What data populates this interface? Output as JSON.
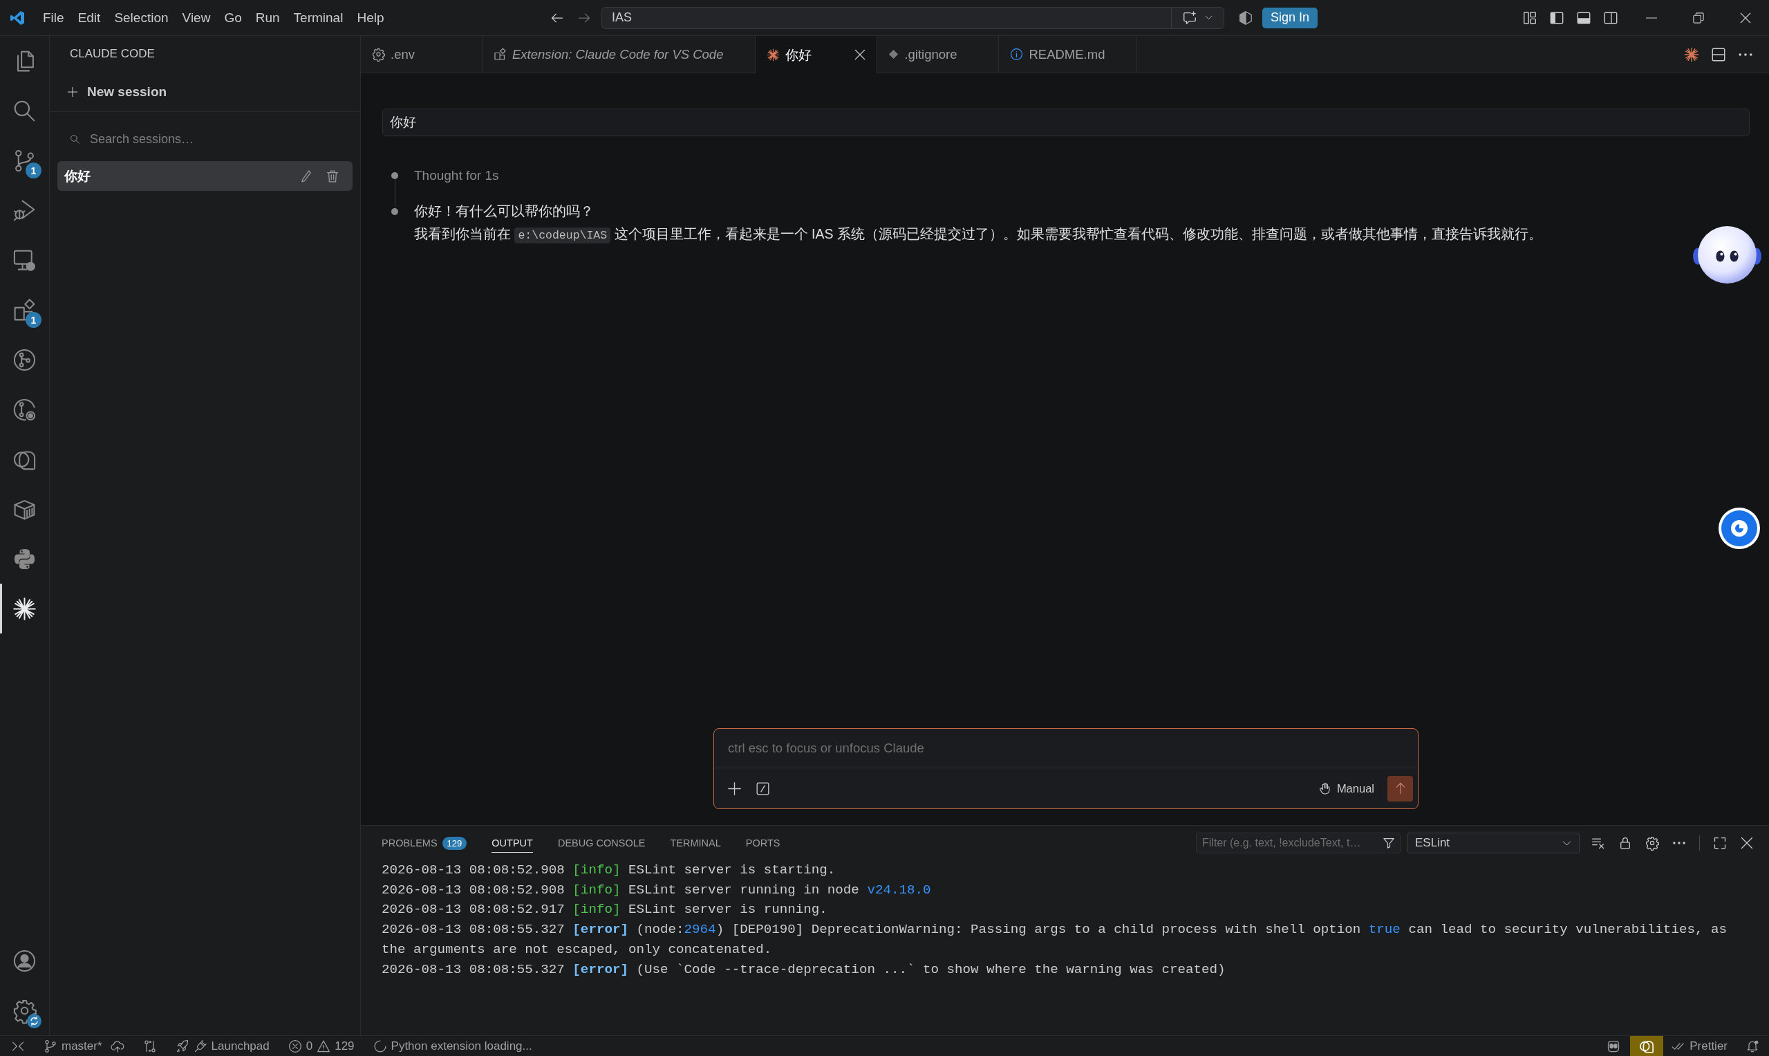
{
  "title_bar": {
    "menus": [
      "File",
      "Edit",
      "Selection",
      "View",
      "Go",
      "Run",
      "Terminal",
      "Help"
    ],
    "command_center": "IAS",
    "sign_in": "Sign In"
  },
  "activity_bar": {
    "items": [
      {
        "kind": "files",
        "selected": false
      },
      {
        "kind": "search",
        "selected": false
      },
      {
        "kind": "source-control",
        "selected": false,
        "badge": "1"
      },
      {
        "kind": "run-debug",
        "selected": false
      },
      {
        "kind": "remote",
        "selected": false
      },
      {
        "kind": "extensions",
        "selected": false,
        "badge": "1"
      },
      {
        "kind": "git-graph",
        "selected": false
      },
      {
        "kind": "gitlens",
        "selected": false
      },
      {
        "kind": "chat",
        "selected": false
      },
      {
        "kind": "containers",
        "selected": false
      },
      {
        "kind": "python",
        "selected": false
      },
      {
        "kind": "claude",
        "selected": true
      }
    ],
    "bottom": [
      {
        "kind": "account"
      },
      {
        "kind": "settings"
      }
    ]
  },
  "sidebar": {
    "title": "CLAUDE CODE",
    "new_session": "New session",
    "search": {
      "placeholder": "Search sessions…"
    },
    "sessions": [
      {
        "label": "你好",
        "selected": true
      }
    ]
  },
  "tabs": [
    {
      "label": ".env",
      "kind": "settings",
      "preview": false,
      "selected": false
    },
    {
      "label": "Extension: Claude Code for VS Code",
      "kind": "extension",
      "preview": true,
      "selected": false
    },
    {
      "label": "你好",
      "kind": "claude",
      "preview": false,
      "selected": true
    },
    {
      "label": ".gitignore",
      "kind": "git",
      "preview": false,
      "selected": false
    },
    {
      "label": "README.md",
      "kind": "info",
      "preview": false,
      "selected": false
    }
  ],
  "chat": {
    "user_message": "你好",
    "thought": "Thought for 1s",
    "reply": [
      {
        "segments": [
          {
            "kind": "plain",
            "text": "你好！有什么可以帮你的吗？"
          }
        ]
      },
      {
        "segments": [
          {
            "kind": "plain",
            "text": "我看到你当前在 "
          },
          {
            "kind": "code",
            "text": "e:\\codeup\\IAS"
          },
          {
            "kind": "plain",
            "text": " 这个项目里工作，看起来是一个 IAS 系统（源码已经提交过了）。如果需要我帮忙查看代码、修改功能、排查问题，或者做其他事情，直接告诉我就行。"
          }
        ]
      }
    ],
    "input": {
      "placeholder": "ctrl esc to focus or unfocus Claude",
      "mode": "Manual"
    }
  },
  "panel": {
    "tabs": [
      {
        "label": "PROBLEMS",
        "badge": "129",
        "selected": false
      },
      {
        "label": "OUTPUT",
        "selected": true
      },
      {
        "label": "DEBUG CONSOLE",
        "selected": false
      },
      {
        "label": "TERMINAL",
        "selected": false
      },
      {
        "label": "PORTS",
        "selected": false
      }
    ],
    "filter": {
      "placeholder": "Filter (e.g. text, !excludeText, t…"
    },
    "channel": "ESLint",
    "lines": [
      {
        "segments": [
          {
            "kind": "plain",
            "text": "2026-08-13 08:08:52.908"
          },
          {
            "kind": "info",
            "text": " [info]"
          },
          {
            "kind": "plain",
            "text": " ESLint server is starting."
          }
        ]
      },
      {
        "segments": [
          {
            "kind": "plain",
            "text": "2026-08-13 08:08:52.908"
          },
          {
            "kind": "info",
            "text": " [info]"
          },
          {
            "kind": "plain",
            "text": " ESLint server running in node "
          },
          {
            "kind": "highlight",
            "text": "v24.18.0"
          }
        ]
      },
      {
        "segments": [
          {
            "kind": "plain",
            "text": "2026-08-13 08:08:52.917"
          },
          {
            "kind": "info",
            "text": " [info]"
          },
          {
            "kind": "plain",
            "text": " ESLint server is running."
          }
        ]
      },
      {
        "segments": [
          {
            "kind": "plain",
            "text": "2026-08-13 08:08:55.327"
          },
          {
            "kind": "error",
            "text": " [error]"
          },
          {
            "kind": "plain",
            "text": " (node:"
          },
          {
            "kind": "highlight",
            "text": "2964"
          },
          {
            "kind": "plain",
            "text": ") [DEP0190] DeprecationWarning: Passing args to a child process with shell option "
          },
          {
            "kind": "highlight",
            "text": "true"
          },
          {
            "kind": "plain",
            "text": " can lead to security vulnerabilities, as the arguments are not escaped, only concatenated."
          }
        ]
      },
      {
        "segments": [
          {
            "kind": "plain",
            "text": "2026-08-13 08:08:55.327"
          },
          {
            "kind": "error",
            "text": " [error]"
          },
          {
            "kind": "plain",
            "text": " (Use `Code --trace-deprecation ...` to show where the warning was created)"
          }
        ]
      }
    ]
  },
  "status_bar": {
    "left": [
      {
        "kind": "remote"
      },
      {
        "kind": "branch",
        "text": "master*"
      },
      {
        "kind": "publish"
      },
      {
        "kind": "compare"
      },
      {
        "kind": "launchpad",
        "text": "Launchpad"
      },
      {
        "kind": "problems",
        "errors": "0",
        "warnings": "129"
      },
      {
        "kind": "loading",
        "text": "Python extension loading..."
      }
    ],
    "right": [
      {
        "kind": "copilot"
      },
      {
        "kind": "highlight"
      },
      {
        "kind": "prettier",
        "text": "Prettier"
      },
      {
        "kind": "notifications"
      }
    ]
  }
}
